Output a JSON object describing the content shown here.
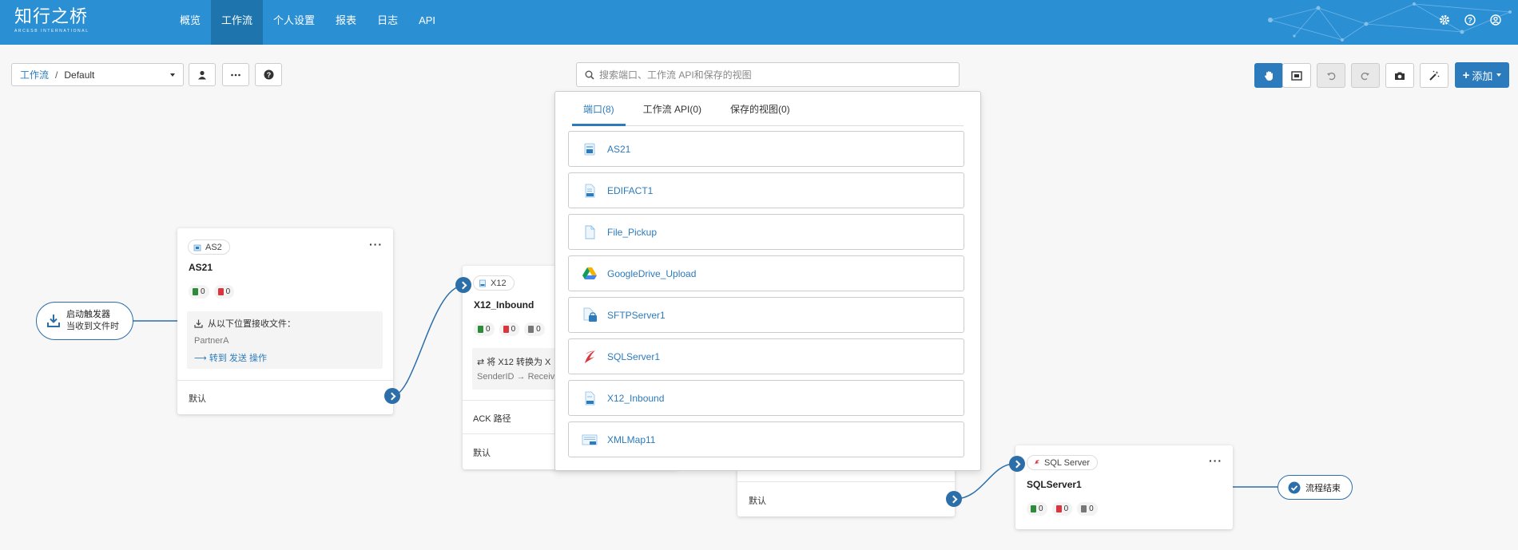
{
  "app": {
    "logo_cn": "知行之桥",
    "logo_en": "ARCESB INTERNATIONAL"
  },
  "nav": [
    "概览",
    "工作流",
    "个人设置",
    "报表",
    "日志",
    "API"
  ],
  "breadcrumb": {
    "root": "工作流",
    "separator": "/",
    "current": "Default"
  },
  "search": {
    "placeholder": "搜索端口、工作流 API和保存的视图"
  },
  "toolbar": {
    "add_label": "添加"
  },
  "dropdown": {
    "tabs": [
      "端口(8)",
      "工作流 API(0)",
      "保存的视图(0)"
    ],
    "ports": [
      {
        "name": "AS21",
        "icon": "as2-icon"
      },
      {
        "name": "EDIFACT1",
        "icon": "edifact-icon"
      },
      {
        "name": "File_Pickup",
        "icon": "file-icon"
      },
      {
        "name": "GoogleDrive_Upload",
        "icon": "google-drive-icon"
      },
      {
        "name": "SFTPServer1",
        "icon": "sftp-icon"
      },
      {
        "name": "SQLServer1",
        "icon": "sql-server-icon"
      },
      {
        "name": "X12_Inbound",
        "icon": "x12-icon"
      },
      {
        "name": "XMLMap11",
        "icon": "xmlmap-icon"
      }
    ]
  },
  "trigger": {
    "title": "启动触发器",
    "subtitle": "当收到文件时"
  },
  "end": {
    "label": "流程结束"
  },
  "cards": {
    "as2": {
      "tag": "AS2",
      "title": "AS21",
      "success": "0",
      "error": "0",
      "info_line": "从以下位置接收文件：",
      "info_sub": "PartnerA",
      "info_link": "⟶ 转到 发送 操作",
      "footer": "默认"
    },
    "x12": {
      "tag": "X12",
      "title": "X12_Inbound",
      "success": "0",
      "error": "0",
      "pending": "0",
      "info_line": "⇄ 将 X12 转换为 X",
      "info_sub": "SenderID → Receiv",
      "ack": "ACK 路径",
      "footer": "默认"
    },
    "hidden": {
      "footer": "默认"
    },
    "sql": {
      "tag": "SQL Server",
      "title": "SQLServer1",
      "success": "0",
      "error": "0",
      "pending": "0"
    }
  },
  "colors": {
    "nav_bg": "#2b8fd4",
    "nav_active": "#1e74ad",
    "accent": "#2b7bbd",
    "success": "#2e8b3a",
    "error": "#d9363e",
    "pending": "#777777"
  }
}
